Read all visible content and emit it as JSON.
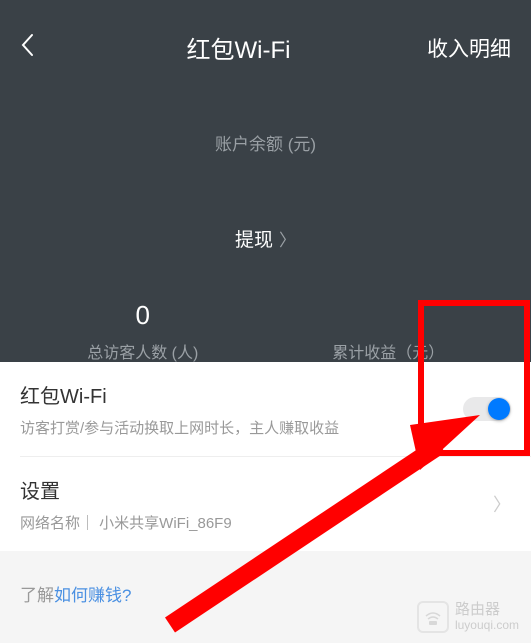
{
  "nav": {
    "title": "红包Wi-Fi",
    "right": "收入明细"
  },
  "balance": {
    "label": "账户余额 (元)"
  },
  "withdraw": {
    "label": "提现"
  },
  "stats": {
    "visitors": {
      "value": "0",
      "label": "总访客人数 (人)"
    },
    "income": {
      "label": "累计收益（元）"
    }
  },
  "wifi_row": {
    "title": "红包Wi-Fi",
    "subtitle": "访客打赏/参与活动换取上网时长，主人赚取收益"
  },
  "settings_row": {
    "title": "设置",
    "subtitle_prefix": "网络名称｜ ",
    "network_name": "小米共享WiFi_86F9"
  },
  "help": {
    "prefix": "了解",
    "link": "如何赚钱?"
  },
  "watermark": {
    "line1": "路由器",
    "line2": "luyouqi.com"
  },
  "colors": {
    "header_bg": "#3a4147",
    "accent": "#007aff",
    "highlight": "#ff0000"
  }
}
